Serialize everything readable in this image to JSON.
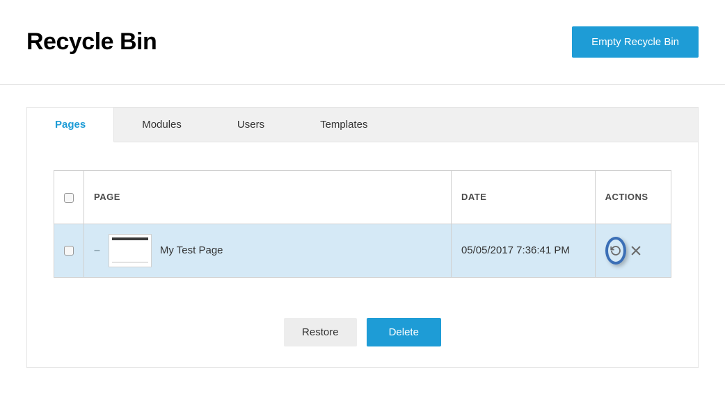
{
  "header": {
    "title": "Recycle Bin",
    "empty_button": "Empty Recycle Bin"
  },
  "tabs": {
    "pages": "Pages",
    "modules": "Modules",
    "users": "Users",
    "templates": "Templates"
  },
  "table": {
    "headers": {
      "page": "PAGE",
      "date": "DATE",
      "actions": "ACTIONS"
    },
    "rows": [
      {
        "name": "My Test Page",
        "date": "05/05/2017 7:36:41 PM"
      }
    ]
  },
  "footer": {
    "restore": "Restore",
    "delete": "Delete"
  }
}
